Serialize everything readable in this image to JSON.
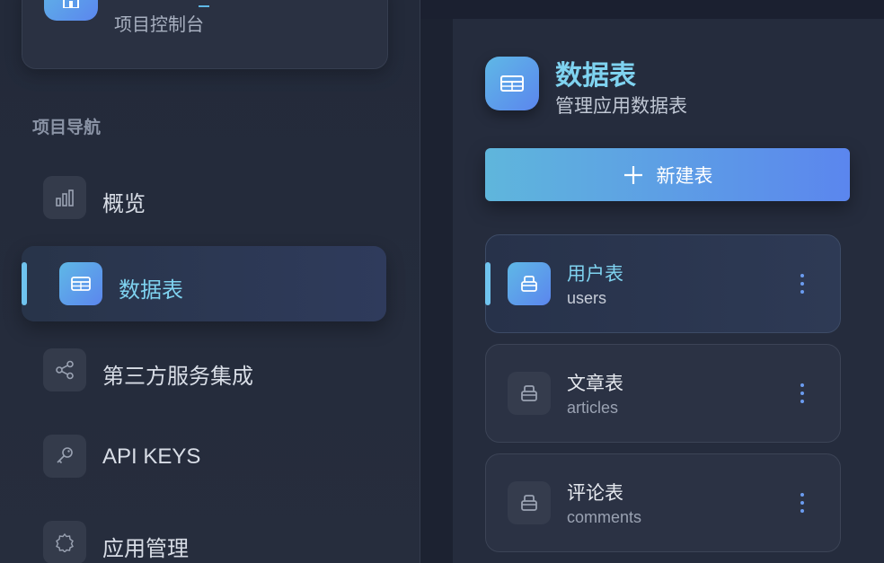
{
  "project": {
    "subtitle": "项目控制台"
  },
  "nav": {
    "heading": "项目导航",
    "items": [
      {
        "label": "概览",
        "icon": "bar-chart-icon"
      },
      {
        "label": "数据表",
        "icon": "table-icon",
        "active": true
      },
      {
        "label": "第三方服务集成",
        "icon": "share-icon"
      },
      {
        "label": "API KEYS",
        "icon": "key-icon"
      },
      {
        "label": "应用管理",
        "icon": "gear-icon"
      }
    ]
  },
  "panel": {
    "title": "数据表",
    "subtitle": "管理应用数据表",
    "new_button": "新建表",
    "tables": [
      {
        "name": "用户表",
        "key": "users",
        "active": true
      },
      {
        "name": "文章表",
        "key": "articles"
      },
      {
        "name": "评论表",
        "key": "comments"
      }
    ]
  },
  "colors": {
    "accent": "#7fd3f0",
    "gradient_start": "#5fb8e6",
    "gradient_end": "#5b86ee",
    "background": "#1a1f2e"
  }
}
